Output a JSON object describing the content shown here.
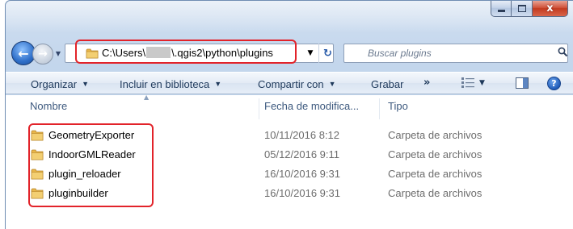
{
  "window": {
    "caption_buttons": {
      "minimize_icon": "minimize-icon",
      "maximize_icon": "maximize-icon",
      "close_glyph": "x"
    }
  },
  "navigation": {
    "back_glyph": "←",
    "forward_glyph": "→",
    "history_caret": "▼"
  },
  "address_bar": {
    "path_prefix": "C:\\Users\\",
    "path_suffix": "\\.qgis2\\python\\plugins",
    "dropdown_glyph": "▼",
    "refresh_glyph": "↻",
    "highlight_color": "#e2232a"
  },
  "search": {
    "placeholder": "Buscar plugins"
  },
  "toolbar": {
    "organize_label": "Organizar",
    "include_label": "Incluir en biblioteca",
    "share_label": "Compartir con",
    "burn_label": "Grabar",
    "more_glyph": "»",
    "caret": "▼",
    "help_glyph": "?"
  },
  "columns": {
    "name": "Nombre",
    "date": "Fecha de modifica...",
    "type": "Tipo"
  },
  "files": [
    {
      "name": "GeometryExporter",
      "date": "10/11/2016 8:12",
      "type": "Carpeta de archivos"
    },
    {
      "name": "IndoorGMLReader",
      "date": "05/12/2016 9:11",
      "type": "Carpeta de archivos"
    },
    {
      "name": "plugin_reloader",
      "date": "16/10/2016 9:31",
      "type": "Carpeta de archivos"
    },
    {
      "name": "pluginbuilder",
      "date": "16/10/2016 9:31",
      "type": "Carpeta de archivos"
    }
  ],
  "colors": {
    "folder": "#e8b64a",
    "accent_blue": "#1e395b",
    "highlight_red": "#e2232a"
  }
}
